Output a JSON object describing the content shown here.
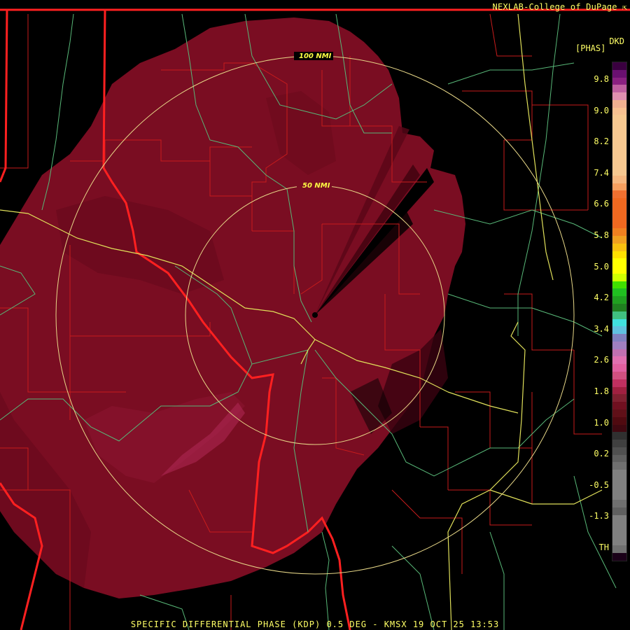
{
  "header": {
    "credit": "NEXLAB-College of DuPage",
    "credit_icon": "external-link-icon"
  },
  "colorbar": {
    "unit_top": "DKD",
    "unit_bottom": "[PHAS]",
    "tick_labels": [
      "9.8",
      "9.0",
      "8.2",
      "7.4",
      "6.6",
      "5.8",
      "5.0",
      "4.2",
      "3.4",
      "2.6",
      "1.8",
      "1.0",
      "0.2",
      "-0.5",
      "-1.3",
      "TH"
    ]
  },
  "rings": {
    "inner_label": "50 NMI",
    "outer_label": "100 NMI"
  },
  "footer": {
    "caption": "SPECIFIC DIFFERENTIAL PHASE (KDP) 0.5 DEG - KMSX 19 OCT 25 13:53"
  },
  "colors": {
    "background": "#000000",
    "echo": "#7a0d22",
    "echo_dark": "#5a0618",
    "state_border": "#ff2020",
    "county": "#d02020",
    "highway_yellow": "#e0e060",
    "highway_green": "#60c080",
    "ring": "#e8d888",
    "text": "#ffff66"
  }
}
